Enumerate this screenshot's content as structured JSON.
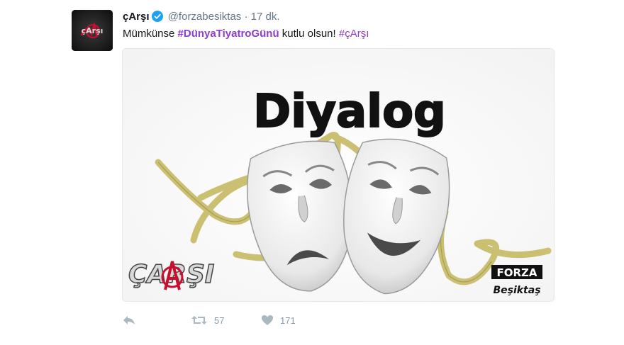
{
  "tweet": {
    "display_name": "çArşı",
    "handle": "@forzabesiktas",
    "separator": "·",
    "time": "17 dk.",
    "text_prefix": "Mümkünse",
    "hashtag_main": "#DünyaTiyatroGünü",
    "text_middle": "kutlu olsun!",
    "hashtag_tail": "#çArşı"
  },
  "avatar": {
    "logo_text": "çArşı"
  },
  "media": {
    "title": "Diyalog",
    "left_logo": "ÇARŞI",
    "right_logo_top": "FORZA",
    "right_logo_bottom": "Beşiktaş"
  },
  "actions": {
    "retweet_count": "57",
    "like_count": "171"
  },
  "colors": {
    "hashtag": "#8e3ccb",
    "verified": "#1da1f2",
    "action_icon": "#aab8c2",
    "ribbon": "#c9bd6a"
  }
}
